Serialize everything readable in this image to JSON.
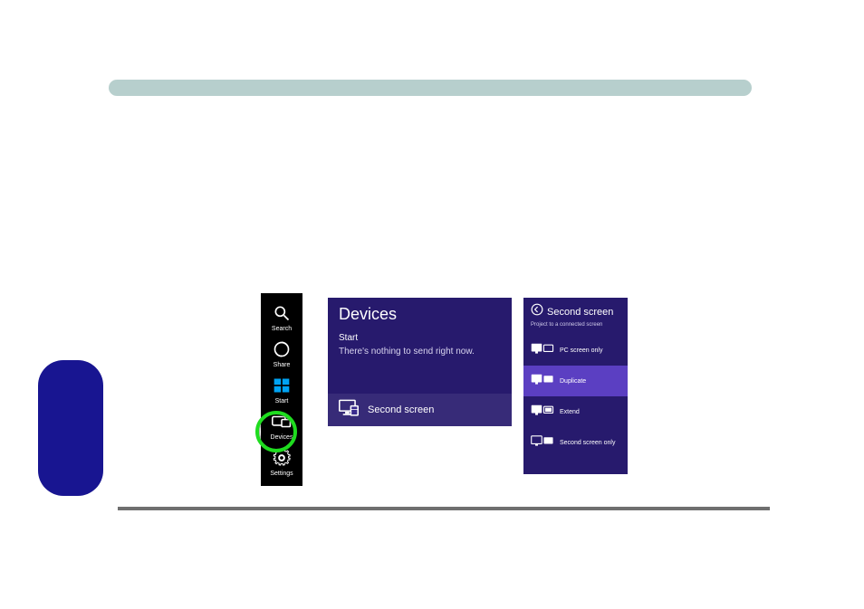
{
  "colors": {
    "panel_bg": "#271a6d",
    "selected_bg": "#5b3fc2",
    "highlight_ring": "#1fdc1f",
    "side_tab": "#181591",
    "top_bar": "#b7cfcd"
  },
  "charms": {
    "items": [
      {
        "label": "Search"
      },
      {
        "label": "Share"
      },
      {
        "label": "Start"
      },
      {
        "label": "Devices"
      },
      {
        "label": "Settings"
      }
    ],
    "highlighted": "Devices"
  },
  "devices_panel": {
    "title": "Devices",
    "subtitle": "Start",
    "caption": "There's nothing to send right now.",
    "second_screen_label": "Second screen"
  },
  "second_screen_panel": {
    "title": "Second screen",
    "caption": "Project to a connected screen",
    "options": [
      {
        "label": "PC screen only"
      },
      {
        "label": "Duplicate"
      },
      {
        "label": "Extend"
      },
      {
        "label": "Second screen only"
      }
    ],
    "selected_index": 1
  }
}
